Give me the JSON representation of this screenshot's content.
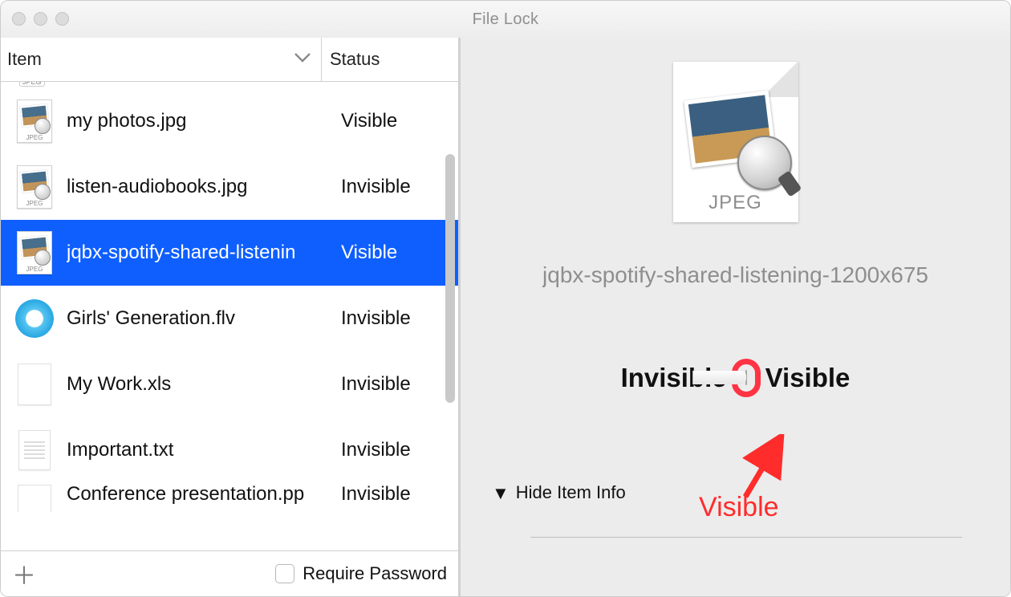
{
  "window": {
    "title": "File Lock"
  },
  "table": {
    "headers": {
      "item": "Item",
      "status": "Status"
    },
    "rows": [
      {
        "name": "my photos.jpg",
        "status": "Visible",
        "icon": "jpeg",
        "selected": false
      },
      {
        "name": "listen-audiobooks.jpg",
        "status": "Invisible",
        "icon": "jpeg",
        "selected": false
      },
      {
        "name": "jqbx-spotify-shared-listenin",
        "status": "Visible",
        "icon": "jpeg",
        "selected": true
      },
      {
        "name": "Girls' Generation.flv",
        "status": "Invisible",
        "icon": "flv",
        "selected": false
      },
      {
        "name": "My Work.xls",
        "status": "Invisible",
        "icon": "blank",
        "selected": false
      },
      {
        "name": "Important.txt",
        "status": "Invisible",
        "icon": "txt",
        "selected": false
      },
      {
        "name": "Conference presentation.pp",
        "status": "Invisible",
        "icon": "blank",
        "selected": false
      }
    ]
  },
  "footer": {
    "require_password": "Require Password"
  },
  "detail": {
    "badge": "JPEG",
    "filename": "jqbx-spotify-shared-listening-1200x675",
    "toggle": {
      "left": "Invisible",
      "right": "Visible",
      "state": "Visible"
    },
    "hide_info": "Hide Item Info"
  },
  "annotation": {
    "label": "Visible"
  }
}
